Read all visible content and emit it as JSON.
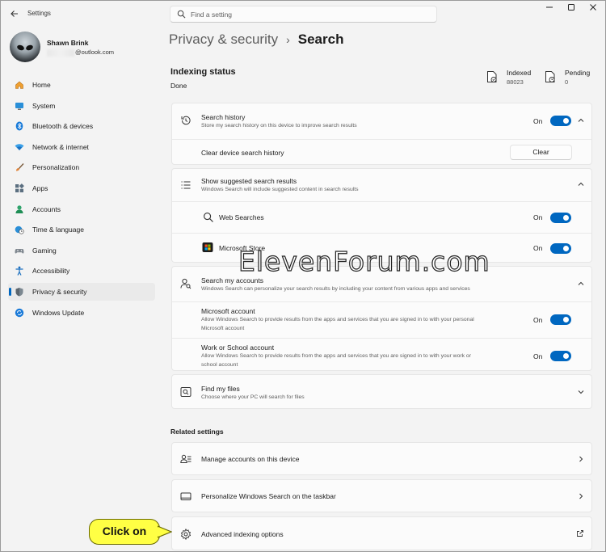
{
  "window": {
    "app_title": "Settings"
  },
  "search": {
    "placeholder": "Find a setting"
  },
  "profile": {
    "name": "Shawn Brink",
    "email_suffix": "@outlook.com"
  },
  "sidebar": {
    "selected": "Privacy & security",
    "items": [
      {
        "label": "Home",
        "icon": "home-icon"
      },
      {
        "label": "System",
        "icon": "monitor-icon"
      },
      {
        "label": "Bluetooth & devices",
        "icon": "bluetooth-icon"
      },
      {
        "label": "Network & internet",
        "icon": "wifi-icon"
      },
      {
        "label": "Personalization",
        "icon": "brush-icon"
      },
      {
        "label": "Apps",
        "icon": "apps-icon"
      },
      {
        "label": "Accounts",
        "icon": "accounts-icon"
      },
      {
        "label": "Time & language",
        "icon": "globe-clock-icon"
      },
      {
        "label": "Gaming",
        "icon": "gamepad-icon"
      },
      {
        "label": "Accessibility",
        "icon": "accessibility-icon"
      },
      {
        "label": "Privacy & security",
        "icon": "shield-icon"
      },
      {
        "label": "Windows Update",
        "icon": "update-icon"
      }
    ]
  },
  "breadcrumb": {
    "parent": "Privacy & security",
    "separator": "›",
    "current": "Search"
  },
  "indexing": {
    "title": "Indexing status",
    "status": "Done",
    "indexed_label": "Indexed",
    "indexed_value": "88023",
    "pending_label": "Pending",
    "pending_value": "0"
  },
  "search_history": {
    "title": "Search history",
    "desc": "Store my search history on this device to improve search results",
    "state": "On",
    "clear_label": "Clear device search history",
    "clear_button": "Clear"
  },
  "suggested": {
    "title": "Show suggested search results",
    "desc": "Windows Search will include suggested content in search results",
    "web_label": "Web Searches",
    "web_state": "On",
    "store_label": "Microsoft Store",
    "store_state": "On"
  },
  "accounts": {
    "title": "Search my accounts",
    "desc": "Windows Search can personalize your search results by including your content from various apps and services",
    "ms_title": "Microsoft account",
    "ms_desc_1": "Allow Windows Search to provide results from the apps and services that you are signed in to with your personal",
    "ms_desc_2": "Microsoft account",
    "ms_state": "On",
    "work_title": "Work or School account",
    "work_desc_1": "Allow Windows Search to provide results from the apps and services that you are signed in to with your work or",
    "work_desc_2": "school account",
    "work_state": "On"
  },
  "find_files": {
    "title": "Find my files",
    "desc": "Choose where your PC will search for files"
  },
  "related": {
    "title": "Related settings",
    "manage_accounts": "Manage accounts on this device",
    "personalize_search": "Personalize Windows Search on the taskbar",
    "advanced_indexing": "Advanced indexing options"
  },
  "watermark": "ElevenForum.com",
  "callout": "Click on",
  "colors": {
    "accent": "#0067c0",
    "callout_bg": "#ffff44"
  }
}
